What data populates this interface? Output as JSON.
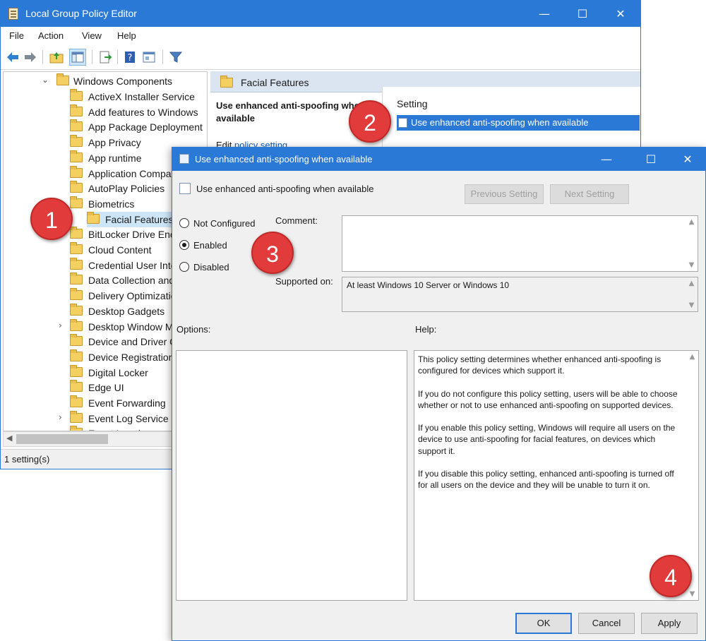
{
  "main_window": {
    "title": "Local Group Policy Editor",
    "caption_buttons": {
      "minimize": "—",
      "maximize": "☐",
      "close": "✕"
    },
    "menu": [
      "File",
      "Action",
      "View",
      "Help"
    ],
    "tree": {
      "root": "Windows Components",
      "items": [
        "ActiveX Installer Service",
        "Add features to Windows",
        "App Package Deployment",
        "App Privacy",
        "App runtime",
        "Application Compatibility",
        "AutoPlay Policies",
        "Biometrics",
        "Facial Features",
        "BitLocker Drive Encryption",
        "Cloud Content",
        "Credential User Interface",
        "Data Collection and",
        "Delivery Optimization",
        "Desktop Gadgets",
        "Desktop Window Manager",
        "Device and Driver Compatibility",
        "Device Registration",
        "Digital Locker",
        "Edge UI",
        "Event Forwarding",
        "Event Log Service",
        "Event Logging"
      ]
    },
    "right_pane": {
      "header": "Facial Features",
      "description_title": "Use enhanced anti-spoofing when available",
      "edit_prefix": "Edit ",
      "edit_link": "policy setting",
      "setting_column": "Setting",
      "selected_setting": "Use enhanced anti-spoofing when available"
    },
    "status": "1 setting(s)"
  },
  "dialog": {
    "title": "Use enhanced anti-spoofing when available",
    "header_title": "Use enhanced anti-spoofing when available",
    "previous_button": "Previous Setting",
    "next_button": "Next Setting",
    "options": {
      "not_configured": "Not Configured",
      "enabled": "Enabled",
      "disabled": "Disabled",
      "selected": "Enabled"
    },
    "comment_label": "Comment:",
    "comment_value": "",
    "supported_label": "Supported on:",
    "supported_value": "At least Windows 10 Server or Windows 10",
    "options_label": "Options:",
    "help_label": "Help:",
    "help_paragraphs": [
      "This policy setting determines whether enhanced anti-spoofing is configured for devices which support it.",
      "If you do not configure this policy setting, users will be able to choose whether or not to use enhanced anti-spoofing on supported devices.",
      "If you enable this policy setting, Windows will require all users on the device to use anti-spoofing for facial features, on devices which support it.",
      "If you disable this policy setting, enhanced anti-spoofing is turned off for all users on the device and they will be unable to turn it on."
    ],
    "ok_button": "OK",
    "cancel_button": "Cancel",
    "apply_button": "Apply"
  },
  "callouts": [
    "1",
    "2",
    "3",
    "4"
  ],
  "colors": {
    "titlebar": "#2b79d6",
    "selection": "#2b79d6",
    "badge": "#e23b3b",
    "folder": "#f4cf62"
  },
  "icons": {
    "back": "arrow-left-icon",
    "forward": "arrow-right-icon",
    "up": "folder-up-icon",
    "console_tree": "console-tree-icon",
    "export": "export-list-icon",
    "help": "help-icon",
    "properties": "properties-icon",
    "filter": "filter-icon"
  }
}
